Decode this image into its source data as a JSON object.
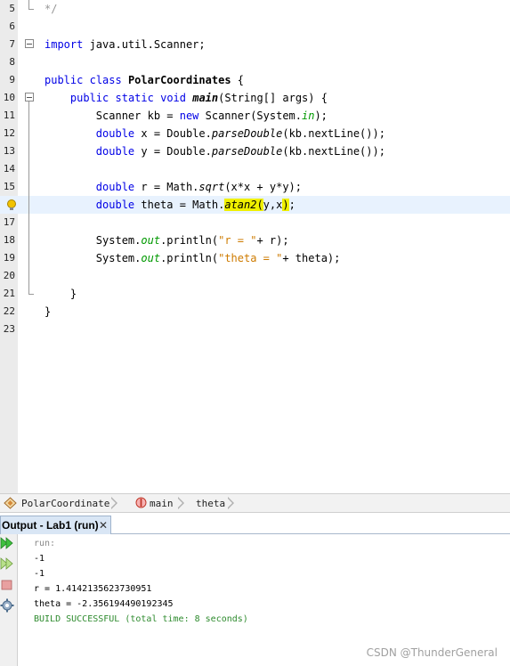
{
  "editor": {
    "lines": [
      {
        "num": "5",
        "tokens": [
          {
            "t": "*/",
            "c": "cm"
          }
        ]
      },
      {
        "num": "6",
        "tokens": []
      },
      {
        "num": "7",
        "tokens": [
          {
            "t": "import",
            "c": "kw"
          },
          {
            "t": " java.util.Scanner;",
            "c": ""
          }
        ]
      },
      {
        "num": "8",
        "tokens": []
      },
      {
        "num": "9",
        "tokens": [
          {
            "t": "public",
            "c": "kw"
          },
          {
            "t": " ",
            "c": ""
          },
          {
            "t": "class",
            "c": "kw"
          },
          {
            "t": " ",
            "c": ""
          },
          {
            "t": "PolarCoordinates",
            "c": "cls"
          },
          {
            "t": " {",
            "c": ""
          }
        ]
      },
      {
        "num": "10",
        "tokens": [
          {
            "t": "    ",
            "c": ""
          },
          {
            "t": "public",
            "c": "kw"
          },
          {
            "t": " ",
            "c": ""
          },
          {
            "t": "static",
            "c": "kw"
          },
          {
            "t": " ",
            "c": ""
          },
          {
            "t": "void",
            "c": "kw"
          },
          {
            "t": " ",
            "c": ""
          },
          {
            "t": "main",
            "c": "mth"
          },
          {
            "t": "(String[] args) {",
            "c": ""
          }
        ]
      },
      {
        "num": "11",
        "tokens": [
          {
            "t": "        Scanner kb = ",
            "c": ""
          },
          {
            "t": "new",
            "c": "kw"
          },
          {
            "t": " Scanner(System.",
            "c": ""
          },
          {
            "t": "in",
            "c": "fld"
          },
          {
            "t": ");",
            "c": ""
          }
        ]
      },
      {
        "num": "12",
        "tokens": [
          {
            "t": "        ",
            "c": ""
          },
          {
            "t": "double",
            "c": "kw"
          },
          {
            "t": " x = Double.",
            "c": ""
          },
          {
            "t": "parseDouble",
            "c": "it"
          },
          {
            "t": "(kb.nextLine());",
            "c": ""
          }
        ]
      },
      {
        "num": "13",
        "tokens": [
          {
            "t": "        ",
            "c": ""
          },
          {
            "t": "double",
            "c": "kw"
          },
          {
            "t": " y = Double.",
            "c": ""
          },
          {
            "t": "parseDouble",
            "c": "it"
          },
          {
            "t": "(kb.nextLine());",
            "c": ""
          }
        ]
      },
      {
        "num": "14",
        "tokens": []
      },
      {
        "num": "15",
        "tokens": [
          {
            "t": "        ",
            "c": ""
          },
          {
            "t": "double",
            "c": "kw"
          },
          {
            "t": " r = Math.",
            "c": ""
          },
          {
            "t": "sqrt",
            "c": "it"
          },
          {
            "t": "(x*x + y*y);",
            "c": ""
          }
        ]
      },
      {
        "num": "",
        "tokens": [
          {
            "t": "        ",
            "c": ""
          },
          {
            "t": "double",
            "c": "kw"
          },
          {
            "t": " theta = Math.",
            "c": ""
          },
          {
            "t": "atan2",
            "c": "it mark"
          },
          {
            "t": "(",
            "c": "mark"
          },
          {
            "t": "y,x",
            "c": ""
          },
          {
            "t": ")",
            "c": "mark"
          },
          {
            "t": ";",
            "c": ""
          }
        ]
      },
      {
        "num": "17",
        "tokens": []
      },
      {
        "num": "18",
        "tokens": [
          {
            "t": "        System.",
            "c": ""
          },
          {
            "t": "out",
            "c": "fld"
          },
          {
            "t": ".println(",
            "c": ""
          },
          {
            "t": "\"r = \"",
            "c": "str"
          },
          {
            "t": "+ r);",
            "c": ""
          }
        ]
      },
      {
        "num": "19",
        "tokens": [
          {
            "t": "        System.",
            "c": ""
          },
          {
            "t": "out",
            "c": "fld"
          },
          {
            "t": ".println(",
            "c": ""
          },
          {
            "t": "\"theta = \"",
            "c": "str"
          },
          {
            "t": "+ theta);",
            "c": ""
          }
        ]
      },
      {
        "num": "20",
        "tokens": []
      },
      {
        "num": "21",
        "tokens": [
          {
            "t": "    }",
            "c": ""
          }
        ]
      },
      {
        "num": "22",
        "tokens": [
          {
            "t": "}",
            "c": ""
          }
        ]
      },
      {
        "num": "23",
        "tokens": []
      }
    ]
  },
  "breadcrumb": {
    "items": [
      "PolarCoordinates",
      "main",
      "theta"
    ]
  },
  "output": {
    "tab_title": "Output - Lab1 (run)",
    "close_glyph": "✕",
    "lines": [
      {
        "text": "run:",
        "style": "gray"
      },
      {
        "text": "-1",
        "style": ""
      },
      {
        "text": "-1",
        "style": ""
      },
      {
        "text": "r = 1.4142135623730951",
        "style": ""
      },
      {
        "text": "theta = -2.356194490192345",
        "style": ""
      },
      {
        "text": "BUILD SUCCESSFUL (total time: 8 seconds)",
        "style": "green"
      }
    ]
  },
  "watermark": "CSDN @ThunderGeneral",
  "icons": {
    "fold": "fold-toggle-icon",
    "hint": "lightbulb-icon",
    "class": "class-icon",
    "method": "method-icon",
    "rerun": "rerun-icon",
    "stop": "stop-icon",
    "settings": "settings-icon"
  }
}
